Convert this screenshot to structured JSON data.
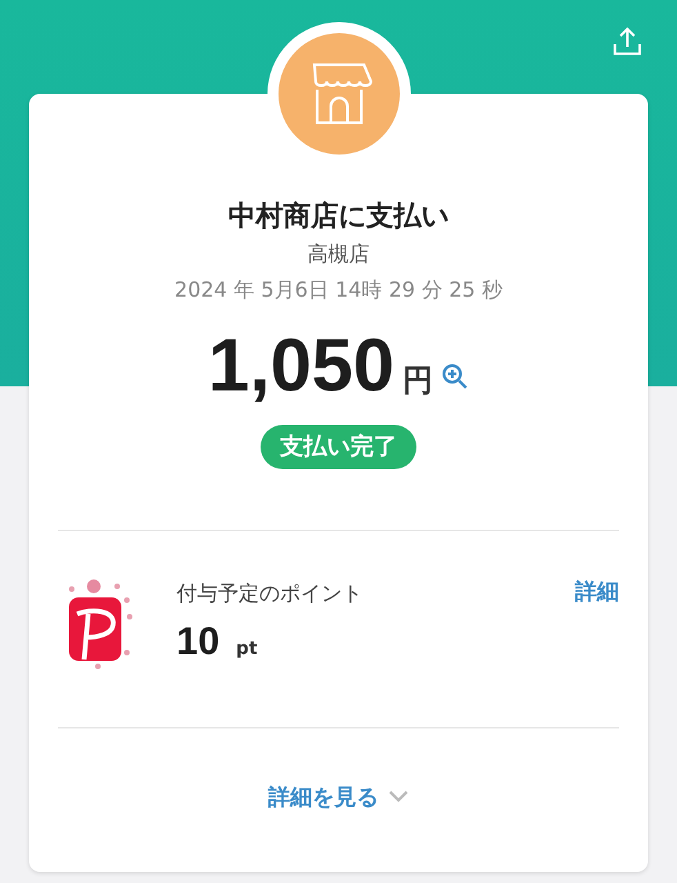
{
  "payment": {
    "merchant": "中村商店に支払い",
    "branch": "高槻店",
    "datetime": "2024 年 5月6日 14時 29 分 25 秒",
    "amount": "1,050",
    "currency": "円",
    "status": "支払い完了"
  },
  "points": {
    "label": "付与予定のポイント",
    "value": "10",
    "unit": "pt",
    "detail_link": "詳細"
  },
  "footer_link": "詳細を見る"
}
